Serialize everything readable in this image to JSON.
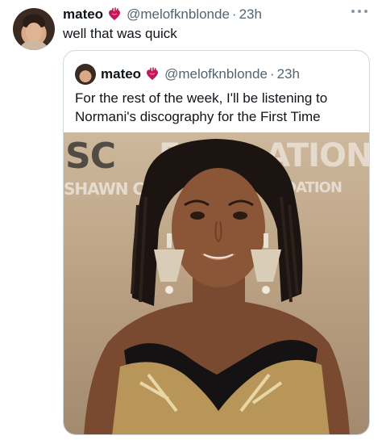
{
  "tweet": {
    "author_name": "mateo",
    "author_handle": "@melofknblonde",
    "separator": "·",
    "time": "23h",
    "text": "well that was quick",
    "badge_icon": "anatomical-heart-icon",
    "menu_icon": "more-options-icon"
  },
  "quoted_tweet": {
    "author_name": "mateo",
    "author_handle": "@melofknblonde",
    "separator": "·",
    "time": "23h",
    "text": "For the rest of the week, I'll be listening to Normani's discography for the First Time",
    "badge_icon": "anatomical-heart-icon"
  },
  "photo": {
    "backdrop_text": [
      "SC",
      "F",
      "ATION",
      "SHAWN C",
      "NDATION"
    ]
  }
}
